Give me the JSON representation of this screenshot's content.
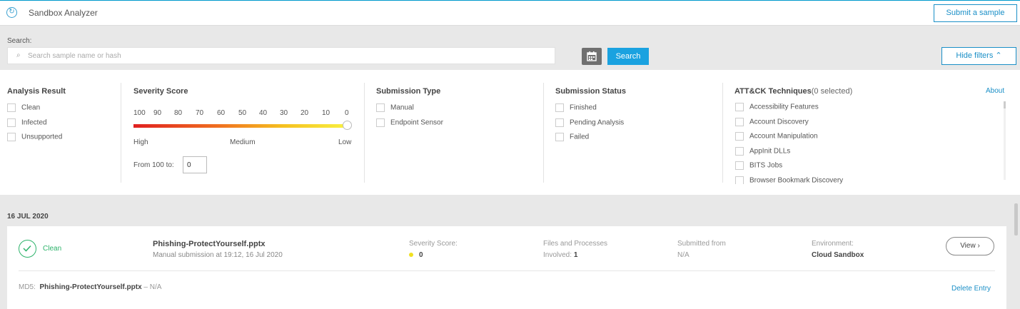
{
  "header": {
    "title": "Sandbox Analyzer",
    "submit_label": "Submit a sample"
  },
  "search": {
    "label": "Search:",
    "placeholder": "Search sample name or hash",
    "button_label": "Search",
    "hide_filters_label": "Hide filters ⌃"
  },
  "filters": {
    "analysis_result": {
      "title": "Analysis Result",
      "options": [
        "Clean",
        "Infected",
        "Unsupported"
      ]
    },
    "severity": {
      "title": "Severity Score",
      "ticks": [
        "100",
        "90",
        "80",
        "70",
        "60",
        "50",
        "40",
        "30",
        "20",
        "10",
        "0"
      ],
      "high_label": "High",
      "medium_label": "Medium",
      "low_label": "Low",
      "from_label": "From 100 to:",
      "from_value": "0"
    },
    "submission_type": {
      "title": "Submission Type",
      "options": [
        "Manual",
        "Endpoint Sensor"
      ]
    },
    "submission_status": {
      "title": "Submission Status",
      "options": [
        "Finished",
        "Pending Analysis",
        "Failed"
      ]
    },
    "attack": {
      "title": "ATT&CK Techniques",
      "selected_count": "(0 selected)",
      "about_label": "About",
      "options": [
        "Accessibility Features",
        "Account Discovery",
        "Account Manipulation",
        "AppInit DLLs",
        "BITS Jobs",
        "Browser Bookmark Discovery"
      ]
    }
  },
  "results": {
    "date": "16 JUL 2020",
    "entry": {
      "status": "Clean",
      "file_name": "Phishing-ProtectYourself.pptx",
      "submission_info": "Manual submission at 19:12, 16 Jul 2020",
      "severity_label": "Severity Score:",
      "severity_value": "0",
      "files_label": "Files and Processes",
      "involved_label": "Involved:",
      "involved_value": "1",
      "submitted_from_label": "Submitted from",
      "submitted_from_value": "N/A",
      "environment_label": "Environment:",
      "environment_value": "Cloud Sandbox",
      "view_label": "View ›",
      "md5_label": "MD5:",
      "md5_file": "Phishing-ProtectYourself.pptx",
      "md5_value": "– N/A",
      "delete_label": "Delete Entry"
    }
  },
  "colors": {
    "accent": "#1a8fc7",
    "clean": "#2db36b",
    "search_button": "#1aa2e0"
  }
}
